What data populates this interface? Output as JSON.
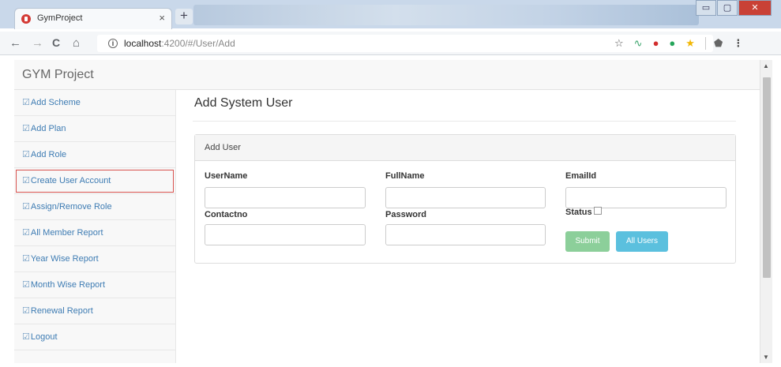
{
  "browser": {
    "tab_title": "GymProject",
    "tab_close": "×",
    "new_tab": "+",
    "window_controls": {
      "minimize": "▭",
      "maximize": "▢",
      "close": "✕"
    },
    "nav": {
      "back": "←",
      "forward": "→",
      "reload": "C",
      "home": "⌂"
    },
    "url_host": "localhost",
    "url_path": ":4200/#/User/Add",
    "extensions": [
      "☆",
      "∿",
      "●",
      "●",
      "★",
      "⬟",
      "⋮"
    ],
    "ext_colors": {
      "opera": "#d22e2e",
      "green": "#25a55a",
      "star": "#f2b705"
    }
  },
  "navbar": {
    "brand": "GYM Project"
  },
  "sidebar": {
    "icon": "☑",
    "items": [
      {
        "label": "Add Scheme"
      },
      {
        "label": "Add Plan"
      },
      {
        "label": "Add Role"
      },
      {
        "label": "Create User Account"
      },
      {
        "label": "Assign/Remove Role"
      },
      {
        "label": "All Member Report"
      },
      {
        "label": "Year Wise Report"
      },
      {
        "label": "Month Wise Report"
      },
      {
        "label": "Renewal Report"
      },
      {
        "label": "Logout"
      }
    ]
  },
  "main": {
    "title": "Add System User",
    "panel_title": "Add User",
    "fields": {
      "username": {
        "label": "UserName",
        "value": ""
      },
      "fullname": {
        "label": "FullName",
        "value": ""
      },
      "emailid": {
        "label": "EmailId",
        "value": ""
      },
      "contactno": {
        "label": "Contactno",
        "value": ""
      },
      "password": {
        "label": "Password",
        "value": ""
      }
    },
    "status_label": "Status",
    "submit_label": "Submit",
    "all_users_label": "All Users"
  },
  "scrollbar": {
    "up": "▲",
    "down": "▼"
  }
}
